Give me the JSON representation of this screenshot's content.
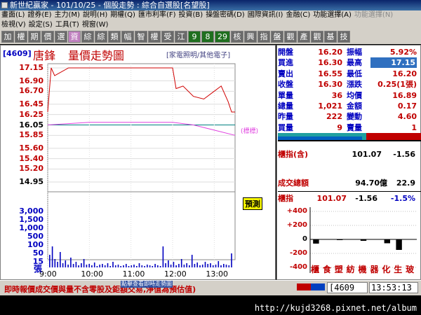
{
  "window": {
    "title": "新世紀贏家 - 101/10/25 - 個股走勢 : 綜合自選股[名望股]"
  },
  "menu1": [
    "畫面(L)",
    "證券(E)",
    "主力(M)",
    "說明(H)",
    "期權(Q)",
    "匯市利率(F)",
    "投資(B)",
    "操盤密碼(D)",
    "國際資訊(I)",
    "金融(C)",
    "功能選擇(A)",
    "功能選擇(N)"
  ],
  "menu1_disabled_last": true,
  "menu2": [
    "檢視(V)",
    "設定(S)",
    "工具(T)",
    "視窗(W)"
  ],
  "toolbar": [
    "加",
    "權",
    "期",
    "價",
    "選",
    "資",
    "綜",
    "綜",
    "類",
    "幅",
    "智",
    "權",
    "受",
    "江",
    "9",
    "8",
    "29",
    "核",
    "興",
    "指",
    "盤",
    "觀",
    "產",
    "觀",
    "基",
    "技"
  ],
  "chart": {
    "stock_code": "[4609]",
    "stock_name": "唐鋒",
    "title": "量價走勢圖",
    "category": "[家電照明/其他電子]",
    "limit_label": "(標標)",
    "reference_badge": "預測",
    "volume_unit": "張"
  },
  "chart_data": {
    "type": "line",
    "price_axis": [
      17.15,
      16.9,
      16.7,
      16.45,
      16.25,
      16.05,
      15.85,
      15.6,
      15.4,
      15.2,
      14.95
    ],
    "reference_price": 16.05,
    "volume_axis": [
      3000,
      1500,
      1000,
      500,
      100,
      50,
      15
    ],
    "time_labels": [
      "9:00",
      "10:00",
      "11:00",
      "12:00",
      "13:00"
    ],
    "price_series": [
      [
        "9:00",
        16.3
      ],
      [
        "9:05",
        17.15
      ],
      [
        "9:10",
        17.0
      ],
      [
        "9:30",
        17.15
      ],
      [
        "10:00",
        17.15
      ],
      [
        "11:00",
        17.15
      ],
      [
        "11:45",
        17.15
      ],
      [
        "12:00",
        17.15
      ],
      [
        "12:05",
        16.75
      ],
      [
        "12:15",
        16.8
      ],
      [
        "12:30",
        16.6
      ],
      [
        "12:45",
        16.55
      ],
      [
        "13:00",
        16.7
      ],
      [
        "13:10",
        16.8
      ],
      [
        "13:20",
        16.5
      ],
      [
        "13:25",
        16.3
      ],
      [
        "13:30",
        16.3
      ]
    ],
    "avg_series": [
      [
        "9:00",
        16.05
      ],
      [
        "10:00",
        16.1
      ],
      [
        "11:00",
        16.1
      ],
      [
        "12:00",
        16.1
      ],
      [
        "12:30",
        16.05
      ],
      [
        "13:00",
        15.95
      ],
      [
        "13:30",
        15.85
      ]
    ]
  },
  "quote": {
    "rows": [
      {
        "l1": "開盤",
        "v1": "16.20",
        "l2": "振幅",
        "v2": "5.92%",
        "v2_highlight": false
      },
      {
        "l1": "買進",
        "v1": "16.30",
        "l2": "最高",
        "v2": "17.15",
        "v2_highlight": true
      },
      {
        "l1": "賣出",
        "v1": "16.55",
        "l2": "最低",
        "v2": "16.20",
        "v2_highlight": false
      },
      {
        "l1": "收盤",
        "v1": "16.30",
        "l2": "漲跌",
        "v2": "0.25(1張)",
        "v2_highlight": false
      },
      {
        "l1": "單量",
        "v1": "36",
        "l2": "均價",
        "v2": "16.89",
        "v2_highlight": false
      },
      {
        "l1": "總量",
        "v1": "1,021",
        "l2": "金額",
        "v2": "0.17",
        "v2_highlight": false
      },
      {
        "l1": "昨量",
        "v1": "222",
        "l2": "變動",
        "v2": "4.60",
        "v2_highlight": false
      },
      {
        "l1": "買量",
        "v1": "9",
        "l2": "賣量",
        "v2": "1",
        "v2_highlight": false
      }
    ],
    "index_label": "櫃指(含)",
    "index_value": "101.07",
    "index_change": "-1.56",
    "turnover_label": "成交總額",
    "turnover_value": "94.70億",
    "turnover_extra": "22.9",
    "index2_label": "櫃指",
    "index2_value": "101.07",
    "index2_change": "-1.56",
    "index2_pct": "-1.5%"
  },
  "sector_chart": {
    "axis": [
      "+400",
      "+200",
      "0",
      "-200",
      "-400"
    ],
    "sectors": [
      "櫃",
      "食",
      "塑",
      "紡",
      "機",
      "器",
      "化",
      "生",
      "玻"
    ],
    "values": [
      -60,
      0,
      -10,
      5,
      -20,
      0,
      -55,
      -150,
      0
    ]
  },
  "status": {
    "message": "即時報價成交價與量不含零股及鉅額交易,淨值為預估值)",
    "overlap": "點擊查看即時走勢圖",
    "code": "[4609",
    "time": "13:53:13"
  },
  "url": "http://kujd3268.pixnet.net/album"
}
